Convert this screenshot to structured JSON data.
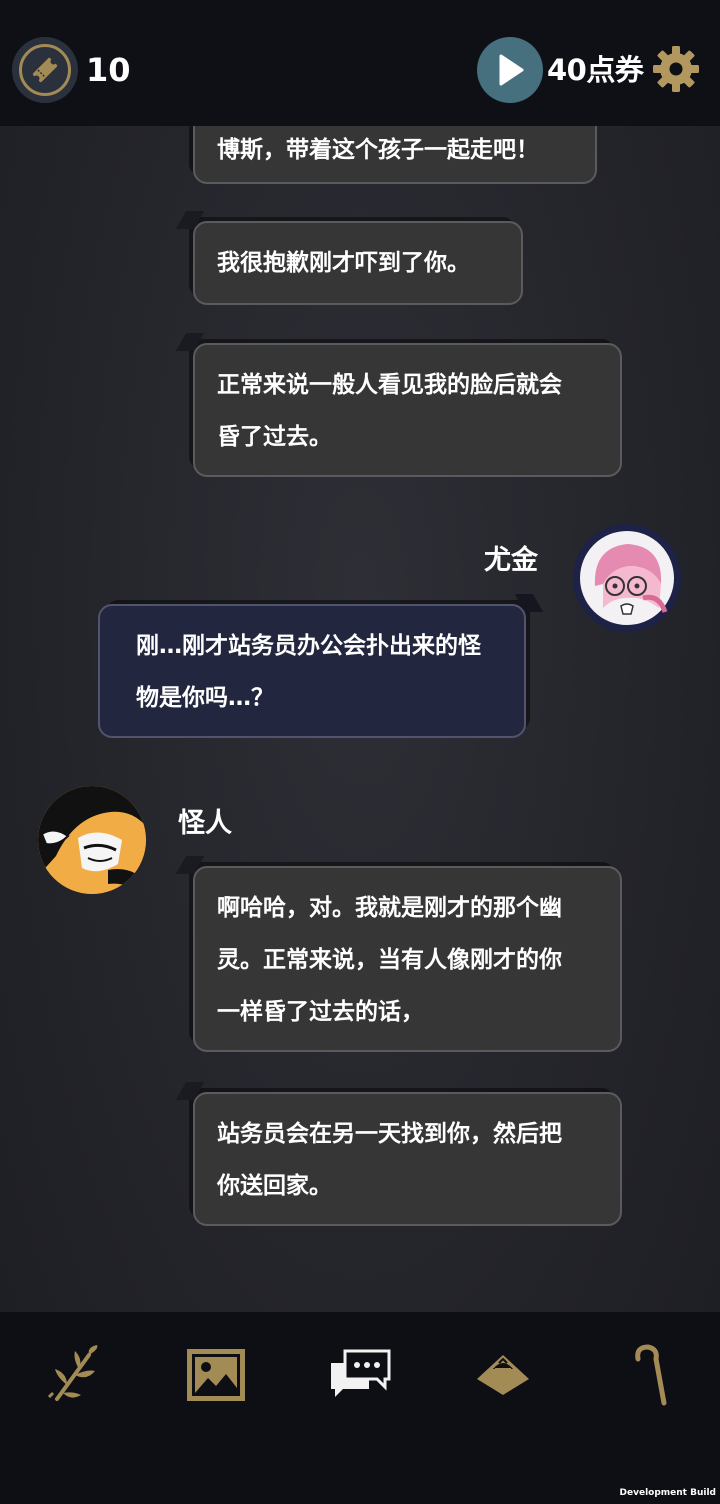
{
  "header": {
    "ticket_count": "10",
    "coupon_label": "40点券"
  },
  "chat": {
    "messages": [
      {
        "speaker": "怪人",
        "side": "npc",
        "lines": [
          "博斯，带着这个孩子一起走吧！"
        ]
      },
      {
        "speaker": "怪人",
        "side": "npc",
        "lines": [
          "我很抱歉刚才吓到了你。"
        ]
      },
      {
        "speaker": "怪人",
        "side": "npc",
        "lines": [
          "正常来说一般人看见我的脸后就会",
          "昏了过去。"
        ]
      },
      {
        "speaker": "尤金",
        "side": "player",
        "lines": [
          "刚…刚才站务员办公会扑出来的怪",
          "物是你吗…？"
        ]
      },
      {
        "speaker": "怪人",
        "side": "npc",
        "lines": [
          "啊哈哈，对。我就是刚才的那个幽",
          "灵。正常来说，当有人像刚才的你",
          "一样昏了过去的话，"
        ]
      },
      {
        "speaker": "怪人",
        "side": "npc",
        "lines": [
          "站务员会在另一天找到你，然后把",
          "你送回家。"
        ]
      }
    ],
    "speaker_eugene": "尤金",
    "speaker_monster": "怪人"
  },
  "nav": {
    "items": [
      {
        "icon": "leaf-branch-icon"
      },
      {
        "icon": "gallery-image-icon"
      },
      {
        "icon": "chat-bubbles-icon"
      },
      {
        "icon": "hat-icon"
      },
      {
        "icon": "cane-icon"
      }
    ]
  },
  "footer": {
    "dev_build": "Development Build"
  },
  "colors": {
    "accent": "#a38b56",
    "play": "#47707f",
    "npc_bubble": "#363636",
    "player_bubble": "#23263f"
  }
}
